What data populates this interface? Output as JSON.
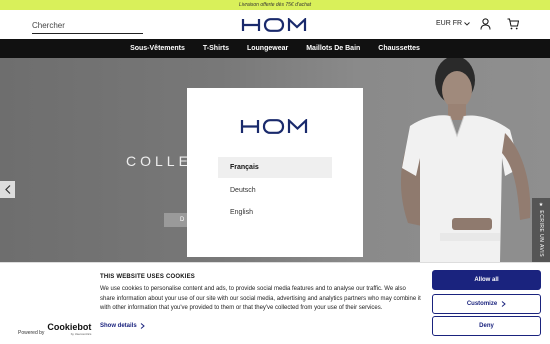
{
  "promo": {
    "text": "Livraison offerte dès 75€ d'achat"
  },
  "header": {
    "search_placeholder": "Chercher",
    "logo": "HOM",
    "currency": "EUR FR"
  },
  "nav": {
    "items": [
      {
        "label": "Sous-Vêtements"
      },
      {
        "label": "T-Shirts"
      },
      {
        "label": "Loungewear"
      },
      {
        "label": "Maillots De Bain"
      },
      {
        "label": "Chaussettes"
      }
    ]
  },
  "hero": {
    "title": "COLLE",
    "button_peek": "D",
    "side_tab": "★ ECRIRE UN AVIS"
  },
  "language_modal": {
    "logo": "HOM",
    "languages": [
      {
        "label": "Français",
        "selected": true
      },
      {
        "label": "Deutsch",
        "selected": false
      },
      {
        "label": "English",
        "selected": false
      }
    ]
  },
  "cookie_banner": {
    "title": "THIS WEBSITE USES COOKIES",
    "body": "We use cookies to personalise content and ads, to provide social media features and to analyse our traffic. We also share information about your use of our site with our social media, advertising and analytics partners who may combine it with other information that you've provided to them or that they've collected from your use of their services.",
    "show_details": "Show details",
    "powered_by": "Powered by",
    "brand": "Cookiebot",
    "brand_sub": "by Usercentrics",
    "buttons": {
      "allow_all": "Allow all",
      "customize": "Customize",
      "deny": "Deny"
    }
  },
  "colors": {
    "promo_bg": "#d9f05a",
    "nav_bg": "#111111",
    "cookie_accent": "#1a237e"
  }
}
